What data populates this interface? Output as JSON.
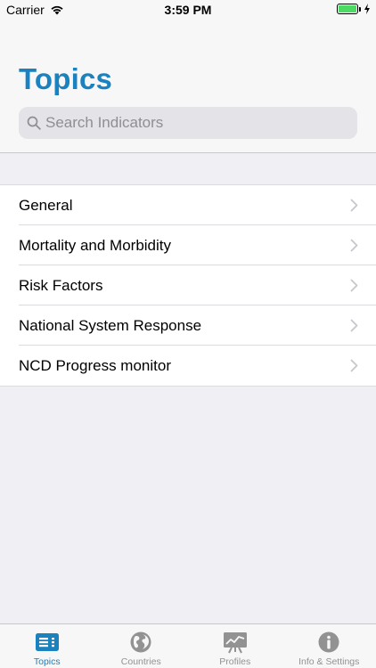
{
  "status_bar": {
    "carrier": "Carrier",
    "time": "3:59 PM",
    "battery_color": "#4cd964"
  },
  "header": {
    "title": "Topics",
    "title_color": "#1a82bf"
  },
  "search": {
    "placeholder": "Search Indicators",
    "value": "",
    "icon": "search-icon"
  },
  "topics": {
    "items": [
      {
        "label": "General",
        "icon": "chevron-right-icon"
      },
      {
        "label": "Mortality and Morbidity",
        "icon": "chevron-right-icon"
      },
      {
        "label": "Risk Factors",
        "icon": "chevron-right-icon"
      },
      {
        "label": "National System Response",
        "icon": "chevron-right-icon"
      },
      {
        "label": "NCD Progress monitor",
        "icon": "chevron-right-icon"
      }
    ]
  },
  "tab_bar": {
    "active_color": "#1a82bf",
    "inactive_color": "#929292",
    "tabs": [
      {
        "label": "Topics",
        "icon": "list-icon",
        "active": true
      },
      {
        "label": "Countries",
        "icon": "globe-icon",
        "active": false
      },
      {
        "label": "Profiles",
        "icon": "chart-easel-icon",
        "active": false
      },
      {
        "label": "Info & Settings",
        "icon": "info-icon",
        "active": false
      }
    ]
  }
}
